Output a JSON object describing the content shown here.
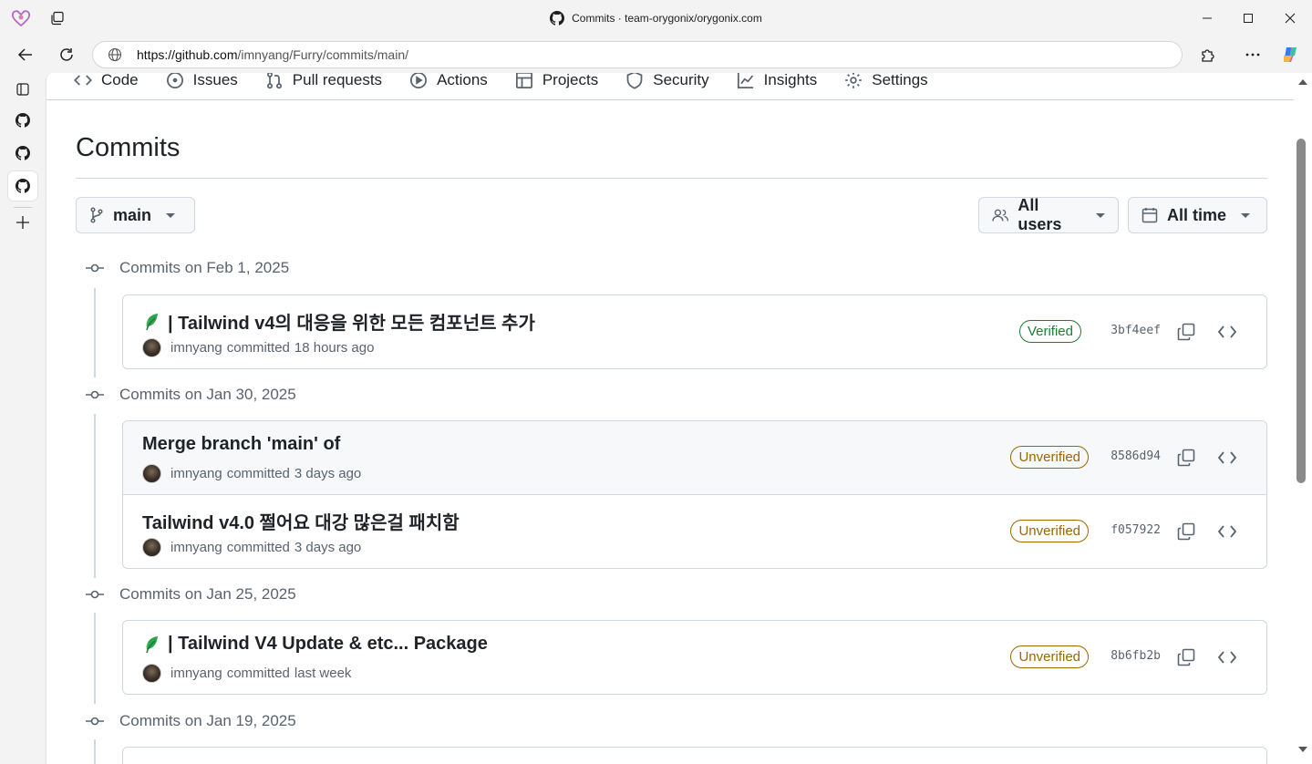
{
  "browser": {
    "tab_title": "Commits · team-orygonix/orygonix.com",
    "url_host": "https://github.com",
    "url_path": "/imnyang/Furry/commits/main/"
  },
  "repo_nav": {
    "items": [
      {
        "label": "Code",
        "icon": "code-icon"
      },
      {
        "label": "Issues",
        "icon": "issue-icon"
      },
      {
        "label": "Pull requests",
        "icon": "pull-request-icon"
      },
      {
        "label": "Actions",
        "icon": "play-icon"
      },
      {
        "label": "Projects",
        "icon": "table-icon"
      },
      {
        "label": "Security",
        "icon": "shield-icon"
      },
      {
        "label": "Insights",
        "icon": "graph-icon"
      },
      {
        "label": "Settings",
        "icon": "gear-icon"
      }
    ]
  },
  "page": {
    "title": "Commits",
    "branch": "main",
    "users_filter": "All users",
    "time_filter": "All time"
  },
  "groups": [
    {
      "heading": "Commits on Feb 1, 2025",
      "commits": [
        {
          "leaf": true,
          "title": "| Tailwind v4의 대응을 위한 모든 컴포넌트 추가",
          "author": "imnyang",
          "action": "committed",
          "when": "18 hours ago",
          "badge": "Verified",
          "sha": "3bf4eef"
        }
      ]
    },
    {
      "heading": "Commits on Jan 30, 2025",
      "commits": [
        {
          "leaf": false,
          "title": "Merge branch 'main' of",
          "author": "imnyang",
          "action": "committed",
          "when": "3 days ago",
          "badge": "Unverified",
          "sha": "8586d94"
        },
        {
          "leaf": false,
          "title": "Tailwind v4.0 쩔어요 대강 많은걸 패치함",
          "author": "imnyang",
          "action": "committed",
          "when": "3 days ago",
          "badge": "Unverified",
          "sha": "f057922"
        }
      ]
    },
    {
      "heading": "Commits on Jan 25, 2025",
      "commits": [
        {
          "leaf": true,
          "title": "| Tailwind V4 Update & etc... Package",
          "author": "imnyang",
          "action": "committed",
          "when": "last week",
          "badge": "Unverified",
          "sha": "8b6fb2b"
        }
      ]
    },
    {
      "heading": "Commits on Jan 19, 2025",
      "commits": []
    }
  ],
  "colors": {
    "verified": "#1a7f37",
    "unverified": "#9a6700",
    "leaf": "#2ea44f"
  }
}
